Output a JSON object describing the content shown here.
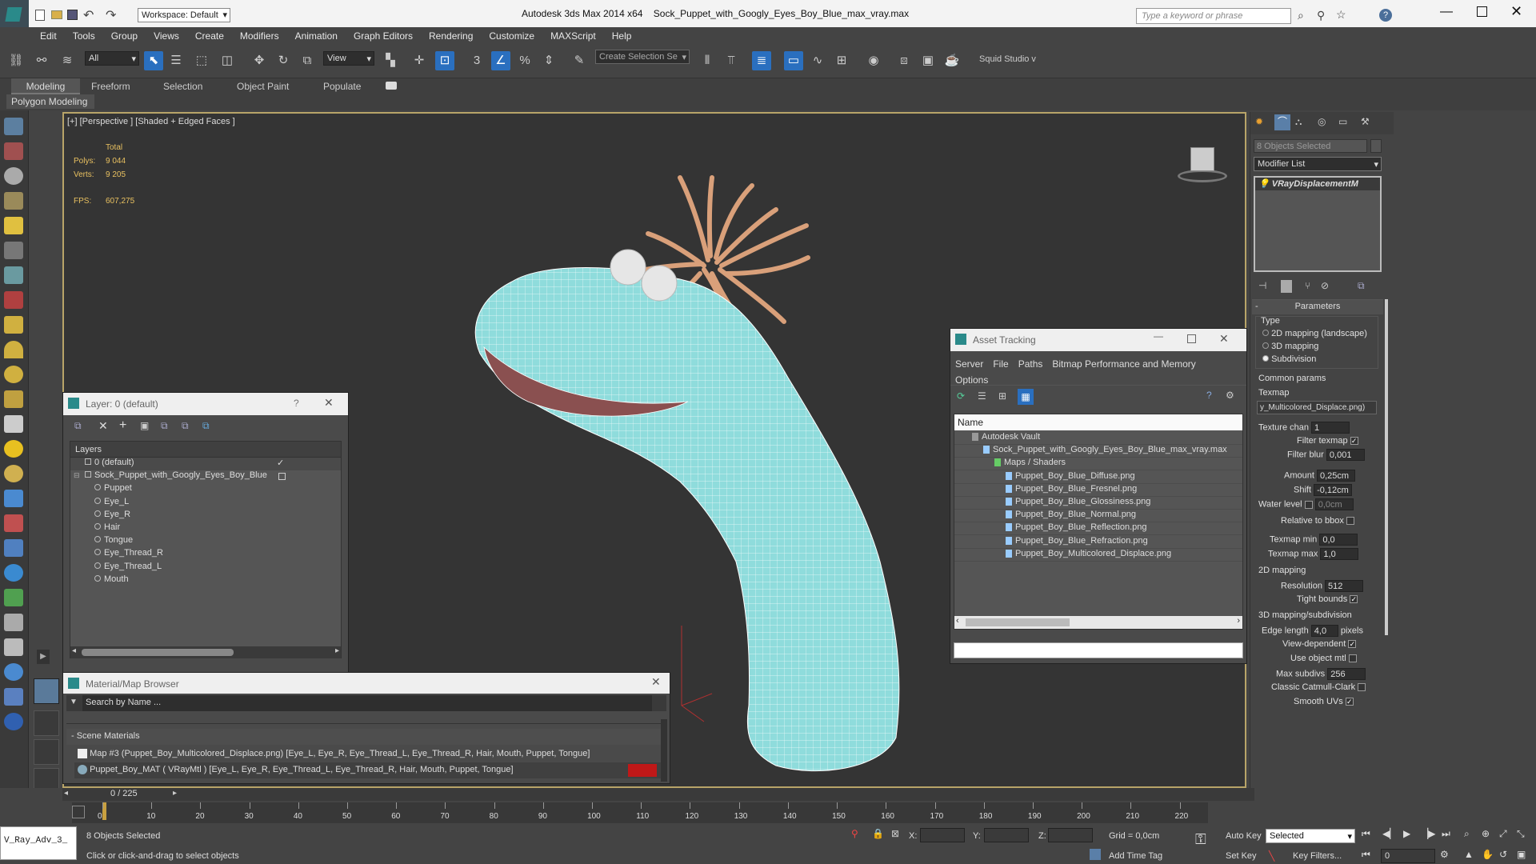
{
  "app": {
    "workspace": "Workspace: Default",
    "title_app": "Autodesk 3ds Max  2014 x64",
    "title_file": "Sock_Puppet_with_Googly_Eyes_Boy_Blue_max_vray.max",
    "search_placeholder": "Type a keyword or phrase"
  },
  "menu": [
    "Edit",
    "Tools",
    "Group",
    "Views",
    "Create",
    "Modifiers",
    "Animation",
    "Graph Editors",
    "Rendering",
    "Customize",
    "MAXScript",
    "Help"
  ],
  "toolbar": {
    "selection_filter": "All",
    "ref_coord": "View",
    "named_sel": "Create Selection Se",
    "snap_num": "3",
    "squid": "Squid Studio v"
  },
  "ribbon": {
    "tabs": [
      "Modeling",
      "Freeform",
      "Selection",
      "Object Paint",
      "Populate"
    ],
    "sub": "Polygon Modeling"
  },
  "viewport": {
    "label": "[+] [Perspective ] [Shaded + Edged Faces ]",
    "stats_total": "Total",
    "polys_label": "Polys:",
    "polys_value": "9 044",
    "verts_label": "Verts:",
    "verts_value": "9 205",
    "fps_label": "FPS:",
    "fps_value": "607,275"
  },
  "layers": {
    "title": "Layer: 0 (default)",
    "help": "?",
    "header": "Layers",
    "items": [
      {
        "name": "0 (default)",
        "level": 0
      },
      {
        "name": "Sock_Puppet_with_Googly_Eyes_Boy_Blue",
        "level": 0
      },
      {
        "name": "Puppet",
        "level": 1
      },
      {
        "name": "Eye_L",
        "level": 1
      },
      {
        "name": "Eye_R",
        "level": 1
      },
      {
        "name": "Hair",
        "level": 1
      },
      {
        "name": "Tongue",
        "level": 1
      },
      {
        "name": "Eye_Thread_R",
        "level": 1
      },
      {
        "name": "Eye_Thread_L",
        "level": 1
      },
      {
        "name": "Mouth",
        "level": 1
      }
    ]
  },
  "mat_browser": {
    "title": "Material/Map Browser",
    "search": "Search by Name ...",
    "section": "- Scene Materials",
    "items": [
      "Map #3 (Puppet_Boy_Multicolored_Displace.png)  [Eye_L, Eye_R, Eye_Thread_L, Eye_Thread_R, Hair, Mouth, Puppet, Tongue]",
      "Puppet_Boy_MAT  ( VRayMtl )  [Eye_L, Eye_R, Eye_Thread_L, Eye_Thread_R, Hair, Mouth, Puppet, Tongue]"
    ]
  },
  "asset": {
    "title": "Asset Tracking",
    "menu": [
      "Server",
      "File",
      "Paths",
      "Bitmap Performance and Memory"
    ],
    "menu2": "Options",
    "col": "Name",
    "rows": [
      {
        "name": "Autodesk Vault",
        "level": 0
      },
      {
        "name": "Sock_Puppet_with_Googly_Eyes_Boy_Blue_max_vray.max",
        "level": 1
      },
      {
        "name": "Maps / Shaders",
        "level": 2
      },
      {
        "name": "Puppet_Boy_Blue_Diffuse.png",
        "level": 3
      },
      {
        "name": "Puppet_Boy_Blue_Fresnel.png",
        "level": 3
      },
      {
        "name": "Puppet_Boy_Blue_Glossiness.png",
        "level": 3
      },
      {
        "name": "Puppet_Boy_Blue_Normal.png",
        "level": 3
      },
      {
        "name": "Puppet_Boy_Blue_Reflection.png",
        "level": 3
      },
      {
        "name": "Puppet_Boy_Blue_Refraction.png",
        "level": 3
      },
      {
        "name": "Puppet_Boy_Multicolored_Displace.png",
        "level": 3
      }
    ]
  },
  "cmd": {
    "selected": "8 Objects Selected",
    "modlist": "Modifier List",
    "modifier": "VRayDisplacementM",
    "params": "Parameters",
    "type": "Type",
    "opt1": "2D mapping (landscape)",
    "opt2": "3D mapping",
    "opt3": "Subdivision",
    "common": "Common params",
    "texmap": "Texmap",
    "texmap_val": "y_Multicolored_Displace.png)",
    "texchan_l": "Texture chan",
    "texchan": "1",
    "filtertex": "Filter texmap",
    "filterblur_l": "Filter blur",
    "filterblur": "0,001",
    "amount_l": "Amount",
    "amount": "0,25cm",
    "shift_l": "Shift",
    "shift": "-0,12cm",
    "water_l": "Water level",
    "water": "0,0cm",
    "relbox": "Relative to bbox",
    "tmin_l": "Texmap min",
    "tmin": "0,0",
    "tmax_l": "Texmap max",
    "tmax": "1,0",
    "map2d": "2D mapping",
    "res_l": "Resolution",
    "res": "512",
    "tight": "Tight bounds",
    "map3d": "3D mapping/subdivision",
    "edge_l": "Edge length",
    "edge": "4,0",
    "pixels": "pixels",
    "viewdep": "View-dependent",
    "useobj": "Use object mtl",
    "maxsub_l": "Max subdivs",
    "maxsub": "256",
    "catmull": "Classic Catmull-Clark",
    "smoothuv": "Smooth UVs"
  },
  "timeline": {
    "frame": "0 / 225",
    "ticks": [
      "0",
      "10",
      "20",
      "30",
      "40",
      "50",
      "60",
      "70",
      "80",
      "90",
      "100",
      "110",
      "120",
      "130",
      "140",
      "150",
      "160",
      "170",
      "180",
      "190",
      "200",
      "210",
      "220"
    ]
  },
  "status": {
    "script": "V_Ray_Adv_3_",
    "selected": "8 Objects Selected",
    "prompt": "Click or click-and-drag to select objects",
    "x": "X:",
    "y": "Y:",
    "z": "Z:",
    "grid": "Grid = 0,0cm",
    "addtime": "Add Time Tag",
    "autokey": "Auto Key",
    "setkey": "Set Key",
    "keysel": "Selected",
    "keyfilters": "Key Filters...",
    "frame": "0"
  }
}
